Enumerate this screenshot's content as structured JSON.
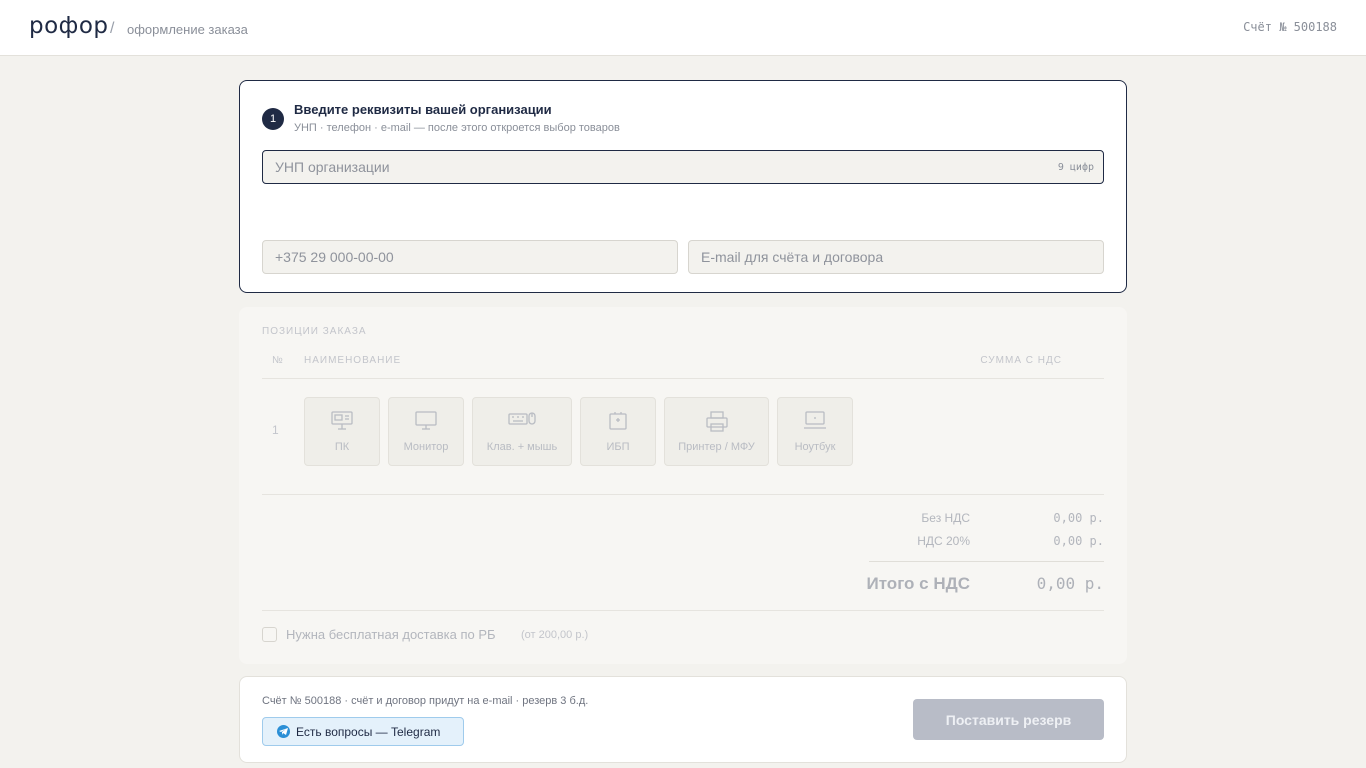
{
  "header": {
    "logo": "рофор",
    "separator": "/",
    "breadcrumb": "оформление заказа",
    "invoice_label": "Счёт № 500188"
  },
  "step1": {
    "badge": "1",
    "title": "Введите реквизиты вашей организации",
    "subtitle": "УНП · телефон · e-mail — после этого откроется выбор товаров",
    "unp_placeholder": "УНП организации",
    "unp_hint": "9 цифр",
    "phone_placeholder": "+375 29 000-00-00",
    "email_placeholder": "E-mail для счёта и договора"
  },
  "order": {
    "section_title": "ПОЗИЦИИ ЗАКАЗА",
    "col_no": "№",
    "col_name": "НАИМЕНОВАНИЕ",
    "col_sum": "СУММА С НДС",
    "row_no": "1",
    "categories": [
      {
        "label": "ПК",
        "icon": "pc-icon"
      },
      {
        "label": "Монитор",
        "icon": "monitor-icon"
      },
      {
        "label": "Клав. + мышь",
        "icon": "keyboard-mouse-icon"
      },
      {
        "label": "ИБП",
        "icon": "ups-icon"
      },
      {
        "label": "Принтер / МФУ",
        "icon": "printer-icon"
      },
      {
        "label": "Ноутбук",
        "icon": "laptop-icon"
      }
    ],
    "totals": {
      "no_vat_label": "Без НДС",
      "no_vat_value": "0,00 р.",
      "vat_label": "НДС 20%",
      "vat_value": "0,00 р.",
      "grand_label": "Итого с НДС",
      "grand_value": "0,00 р."
    },
    "delivery_label": "Нужна бесплатная доставка по РБ",
    "delivery_note": "(от 200,00 р.)"
  },
  "footer": {
    "note": "Счёт № 500188 · счёт и договор придут на e-mail · резерв 3 б.д.",
    "telegram_label": "Есть вопросы — Telegram",
    "reserve_label": "Поставить резерв"
  },
  "colors": {
    "accent": "#1f2a44",
    "background": "#f3f2ee",
    "telegram": "#2b8fd6",
    "button_disabled": "#b8bcc7"
  }
}
